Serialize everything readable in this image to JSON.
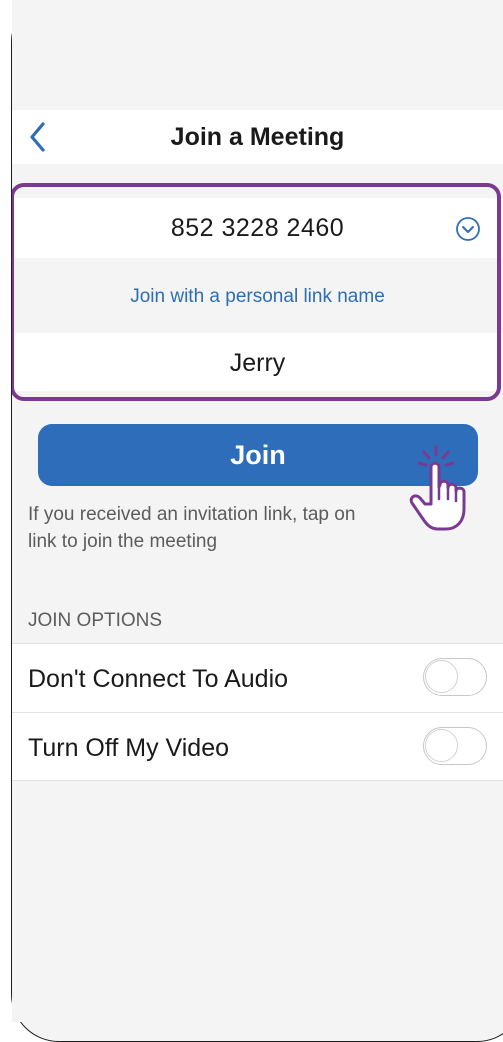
{
  "header": {
    "title": "Join a Meeting",
    "back_icon": "chevron-left-icon"
  },
  "meeting_id_field": {
    "value": "852 3228 2460",
    "dropdown_icon": "chevron-down-circle-icon"
  },
  "personal_link": {
    "label": "Join with a personal link name"
  },
  "name_field": {
    "value": "Jerry"
  },
  "join_button": {
    "label": "Join"
  },
  "hint": {
    "line1": "If you received an invitation link, tap on",
    "line2": "link to join the meeting"
  },
  "join_options": {
    "header": "JOIN OPTIONS",
    "items": [
      {
        "label": "Don't Connect To Audio",
        "enabled": false
      },
      {
        "label": "Turn Off My Video",
        "enabled": false
      }
    ]
  },
  "colors": {
    "accent": "#2e6dba",
    "highlight": "#7b3a91",
    "background": "#f4f4f5",
    "hand": "#7b3a91"
  },
  "annotation": {
    "pointer_icon": "tapping-hand-icon"
  }
}
